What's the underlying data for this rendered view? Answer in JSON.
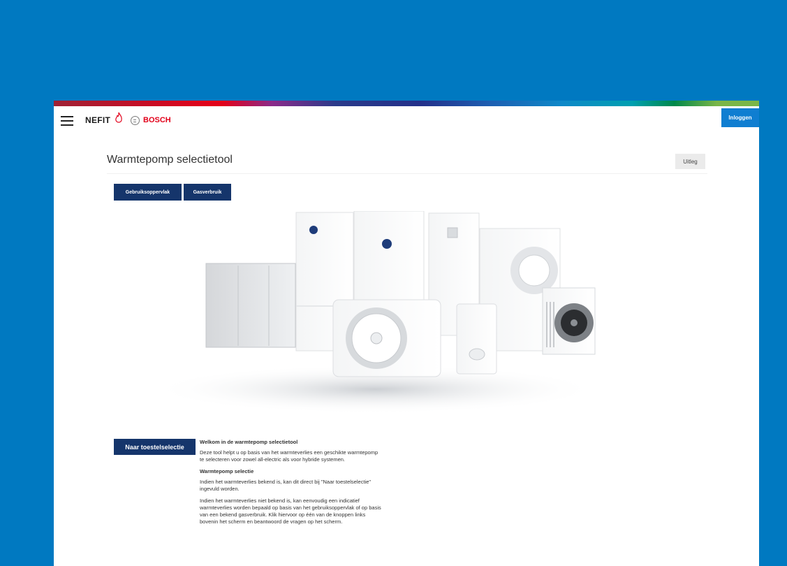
{
  "nav": {
    "brand_nefit": "NEFIT",
    "brand_bosch": "BOSCH",
    "login_label": "Inloggen"
  },
  "page": {
    "title": "Warmtepomp selectietool",
    "uitleg_label": "Uitleg"
  },
  "tabs": [
    {
      "label": "Gebruiksoppervlak"
    },
    {
      "label": "Gasverbruik"
    }
  ],
  "cta": {
    "label": "Naar toestelselectie"
  },
  "intro": {
    "heading": "Welkom in de warmtepomp selectietool",
    "paragraph_1": "Deze tool helpt u op basis van het warmteverlies een geschikte warmtepomp te selecteren voor zowel all-electric als voor hybride systemen.",
    "subheading": "Warmtepomp selectie",
    "paragraph_2": "Indien het warmteverlies bekend is, kan dit direct bij \"Naar toestelselectie\" ingevuld worden.",
    "paragraph_3": "Indien het warmteverlies niet bekend is, kan eenvoudig een indicatief warmteverlies worden bepaald op basis van het gebruiksoppervlak of op basis van een bekend gasverbruik. Klik hiervoor op één van de knoppen links bovenin het scherm en beantwoord de vragen op het scherm."
  },
  "colors": {
    "page_background": "#0079c1",
    "primary_button": "#15356b",
    "login_button": "#0f7ed1",
    "bosch_red": "#e2001a"
  }
}
